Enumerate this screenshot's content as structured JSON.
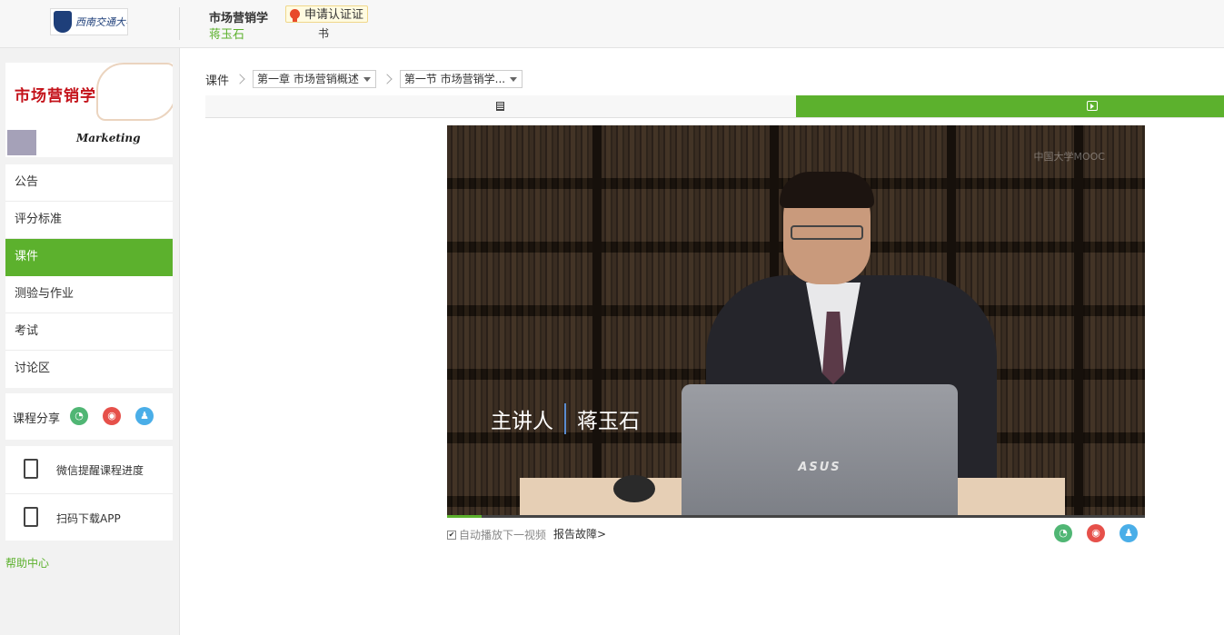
{
  "header": {
    "university_logo_text": "西南交通大学",
    "course_title": "市场营销学",
    "teacher_name": "蒋玉石",
    "cert_button": "申请认证证",
    "cert_button_suffix": "书"
  },
  "sidebar": {
    "cover": {
      "title_cn": "市场营销学",
      "title_en": "Marketing"
    },
    "items": [
      {
        "label": "公告",
        "active": false
      },
      {
        "label": "评分标准",
        "active": false
      },
      {
        "label": "课件",
        "active": true
      },
      {
        "label": "测验与作业",
        "active": false
      },
      {
        "label": "考试",
        "active": false
      },
      {
        "label": "讨论区",
        "active": false
      }
    ],
    "share_label": "课程分享",
    "share_icons": [
      "wechat-icon",
      "weibo-icon",
      "qq-icon"
    ],
    "tools": [
      {
        "label": "微信提醒课程进度",
        "icon": "checklist-icon"
      },
      {
        "label": "扫码下载APP",
        "icon": "phone-icon"
      }
    ],
    "help_link": "帮助中心"
  },
  "breadcrumb": {
    "root": "课件",
    "chapter": "第一章 市场营销概述",
    "section": "第一节 市场营销学..."
  },
  "view_tabs": [
    {
      "icon": "document-icon",
      "active": false
    },
    {
      "icon": "play-icon",
      "active": true
    }
  ],
  "video": {
    "watermark": "中国大学MOOC",
    "speaker_role": "主讲人",
    "speaker_name": "蒋玉石",
    "laptop_brand": "ASUS",
    "progress": 0.05
  },
  "below_video": {
    "autoplay_label": "自动播放下一视频",
    "autoplay_checked": true,
    "report_link": "报告故障>"
  },
  "colors": {
    "accent": "#5cb12d",
    "wechat": "#50b674",
    "weibo": "#e6504a",
    "qq": "#4aaee8"
  }
}
